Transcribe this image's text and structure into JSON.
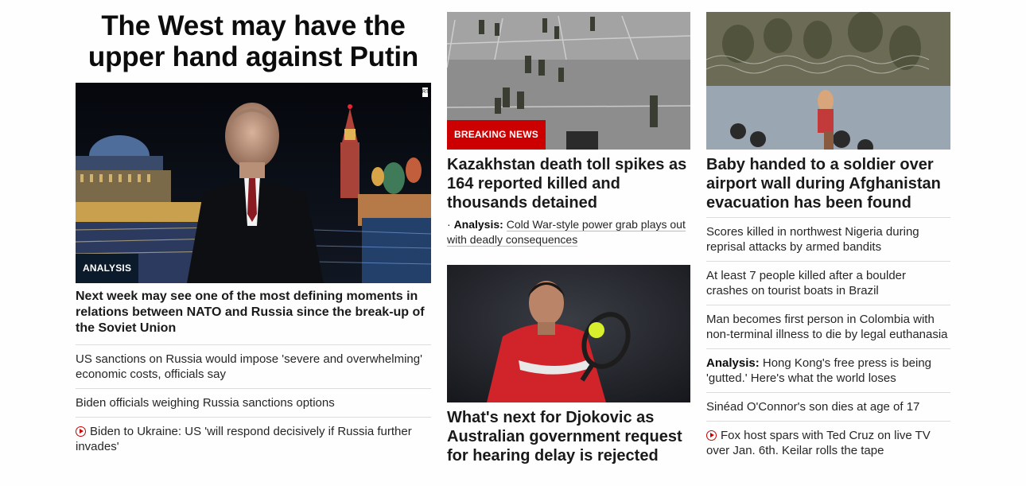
{
  "column1": {
    "title": "The West may have the upper hand against Putin",
    "image_alt": "Vladimir Putin in front of the Kremlin at night",
    "badge": "ANALYSIS",
    "watermark": "RTR",
    "headline": "Next week may see one of the most defining moments in relations between NATO and Russia since the break-up of the Soviet Union",
    "links": [
      {
        "text": "US sanctions on Russia would impose 'severe and overwhelming' economic costs, officials say",
        "video": false
      },
      {
        "text": "Biden officials weighing Russia sanctions options",
        "video": false
      },
      {
        "text": "Biden to Ukraine: US 'will respond decisively if Russia further invades'",
        "video": true
      }
    ]
  },
  "column2": {
    "card1": {
      "image_alt": "Armed soldiers on a square in Kazakhstan",
      "badge": "BREAKING NEWS",
      "headline": "Kazakhstan death toll spikes as 164 reported killed and thousands detained",
      "sub_prefix": "Analysis:",
      "sub_text": "Cold War-style power grab plays out with deadly consequences"
    },
    "card2": {
      "image_alt": "Novak Djokovic hitting a backhand",
      "headline": "What's next for Djokovic as Australian government request for hearing delay is rejected"
    }
  },
  "column3": {
    "image_alt": "Baby handed over an airport wall to a soldier",
    "headline": "Baby handed to a soldier over airport wall during Afghanistan evacuation has been found",
    "links": [
      {
        "prefix": "",
        "text": "Scores killed in northwest Nigeria during reprisal attacks by armed bandits",
        "video": false
      },
      {
        "prefix": "",
        "text": "At least 7 people killed after a boulder crashes on tourist boats in Brazil",
        "video": false
      },
      {
        "prefix": "",
        "text": "Man becomes first person in Colombia with non-terminal illness to die by legal euthanasia",
        "video": false
      },
      {
        "prefix": "Analysis:",
        "text": "Hong Kong's free press is being 'gutted.' Here's what the world loses",
        "video": false
      },
      {
        "prefix": "",
        "text": "Sinéad O'Connor's son dies at age of 17",
        "video": false
      },
      {
        "prefix": "",
        "text": "Fox host spars with Ted Cruz on live TV over Jan. 6th. Keilar rolls the tape",
        "video": true
      }
    ]
  },
  "colors": {
    "breaking": "#cc0000",
    "analysis": "#0c1b2b",
    "divider": "#dcdcdc",
    "video_icon": "#cc0000"
  }
}
